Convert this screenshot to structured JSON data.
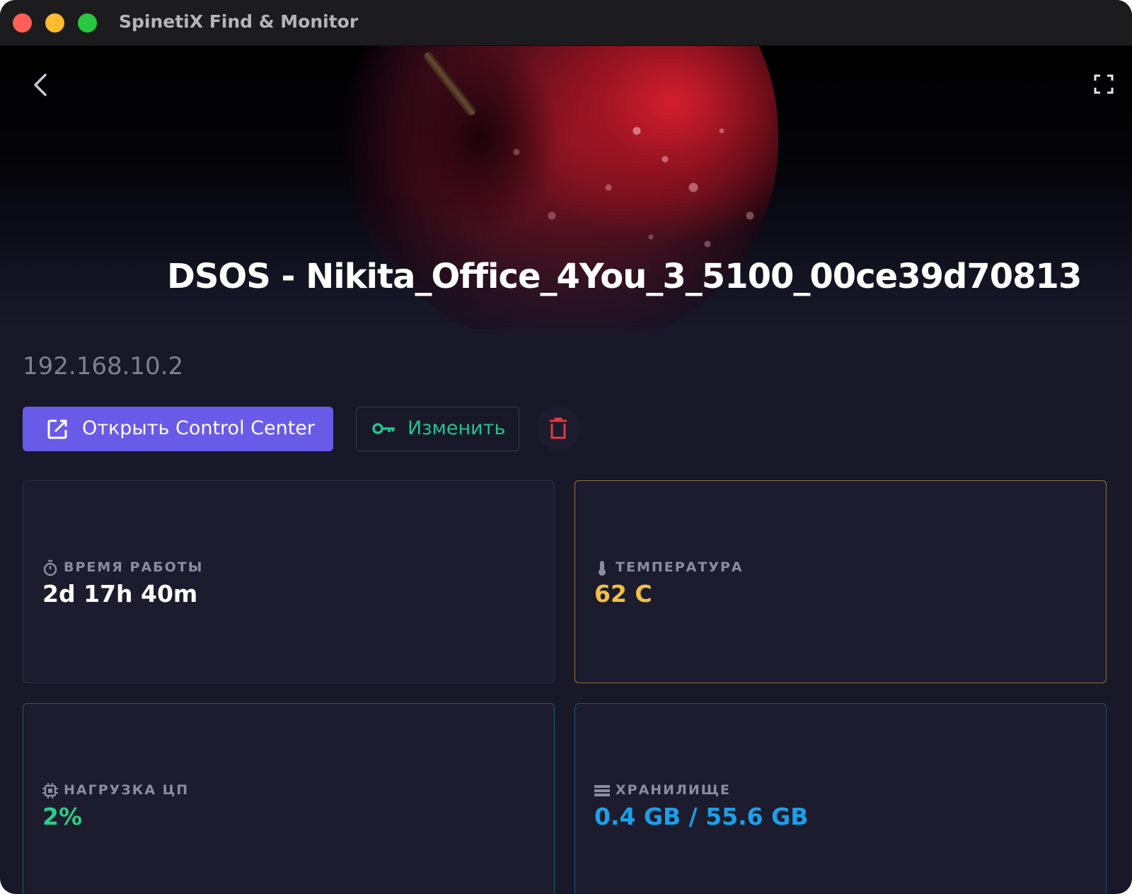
{
  "window": {
    "title": "SpinetiX Find & Monitor"
  },
  "device": {
    "title": "DSOS - Nikita_Office_4You_3_5100_00ce39d70813",
    "ip": "192.168.10.2"
  },
  "actions": {
    "open_control_center": "Открыть Control Center",
    "edit": "Изменить"
  },
  "stats": {
    "uptime": {
      "label": "ВРЕМЯ РАБОТЫ",
      "value": "2d 17h 40m",
      "icon": "stopwatch-icon"
    },
    "temperature": {
      "label": "ТЕМПЕРАТУРА",
      "value": "62 C",
      "icon": "thermometer-icon",
      "color": "#f2c041"
    },
    "cpu": {
      "label": "НАГРУЗКА ЦП",
      "value": "2%",
      "icon": "cpu-chip-icon",
      "color": "#2ecc87"
    },
    "storage": {
      "label": "ХРАНИЛИЩЕ",
      "value": "0.4 GB / 55.6 GB",
      "icon": "storage-icon",
      "color": "#1ca0ea"
    }
  },
  "colors": {
    "accent": "#6a5ae8",
    "edit_green": "#22c38e",
    "delete_red": "#e5393f",
    "background": "#181829"
  }
}
